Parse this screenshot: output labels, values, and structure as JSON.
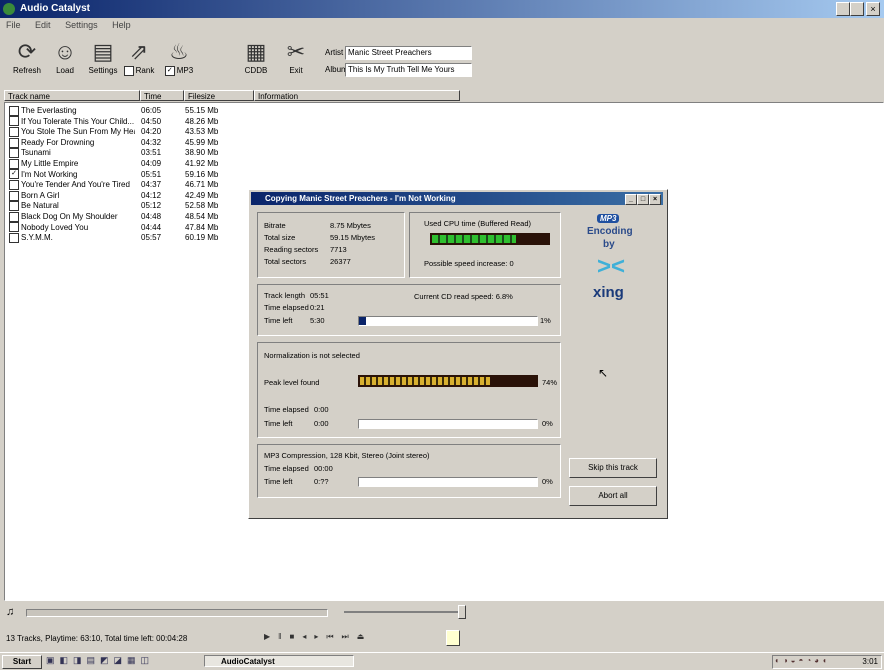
{
  "window": {
    "title": "Audio Catalyst"
  },
  "menu": [
    "File",
    "Edit",
    "Settings",
    "Help"
  ],
  "toolbar": {
    "buttons": [
      {
        "label": "Refresh",
        "icon": "refresh-icon"
      },
      {
        "label": "Load",
        "icon": "load-icon"
      },
      {
        "label": "Settings",
        "icon": "settings-icon"
      },
      {
        "label": "Rank",
        "icon": "rank-icon"
      },
      {
        "label": "MP3",
        "icon": "mp3-icon"
      },
      {
        "label": "CDDB",
        "icon": "cddb-icon"
      },
      {
        "label": "Exit",
        "icon": "exit-icon"
      }
    ],
    "artist_label": "Artist",
    "artist_value": "Manic Street Preachers",
    "album_label": "Album",
    "album_value": "This Is My Truth Tell Me Yours"
  },
  "columns": [
    "Track name",
    "Time",
    "Filesize",
    "Information"
  ],
  "tracks": [
    {
      "name": "The Everlasting",
      "time": "06:05",
      "size": "55.15 Mb",
      "checked": false
    },
    {
      "name": "If You Tolerate This Your Child...",
      "time": "04:50",
      "size": "48.26 Mb",
      "checked": false
    },
    {
      "name": "You Stole The Sun From My Heart",
      "time": "04:20",
      "size": "43.53 Mb",
      "checked": false
    },
    {
      "name": "Ready For Drowning",
      "time": "04:32",
      "size": "45.99 Mb",
      "checked": false
    },
    {
      "name": "Tsunami",
      "time": "03:51",
      "size": "38.90 Mb",
      "checked": false
    },
    {
      "name": "My Little Empire",
      "time": "04:09",
      "size": "41.92 Mb",
      "checked": false
    },
    {
      "name": "I'm Not Working",
      "time": "05:51",
      "size": "59.16 Mb",
      "checked": true
    },
    {
      "name": "You're Tender And You're Tired",
      "time": "04:37",
      "size": "46.71 Mb",
      "checked": false
    },
    {
      "name": "Born A Girl",
      "time": "04:12",
      "size": "42.49 Mb",
      "checked": false
    },
    {
      "name": "Be Natural",
      "time": "05:12",
      "size": "52.58 Mb",
      "checked": false
    },
    {
      "name": "Black Dog On My Shoulder",
      "time": "04:48",
      "size": "48.54 Mb",
      "checked": false
    },
    {
      "name": "Nobody Loved You",
      "time": "04:44",
      "size": "47.84 Mb",
      "checked": false
    },
    {
      "name": "S.Y.M.M.",
      "time": "05:57",
      "size": "60.19 Mb",
      "checked": false
    }
  ],
  "dialog": {
    "title": "Copying Manic Street Preachers - I'm Not Working",
    "stats": [
      {
        "label": "Bitrate",
        "value": "8.75 Mbytes"
      },
      {
        "label": "Total size",
        "value": "59.15 Mbytes"
      },
      {
        "label": "Reading sectors",
        "value": "7713"
      },
      {
        "label": "Total sectors",
        "value": "26377"
      }
    ],
    "cpu_label": "Used CPU time (Buffered Read)",
    "speed_label": "Possible speed increase: 0",
    "track_length_label": "Track length",
    "track_length": "05:51",
    "time_elapsed_label": "Time elapsed",
    "time_elapsed": "0:21",
    "time_left_label": "Time left",
    "time_left": "5:30",
    "read_speed": "Current CD read speed: 6.8%",
    "copy_progress_pct": "1%",
    "copy_progress": 0.01,
    "normalization": "Normalization is not selected",
    "peak_label": "Peak level found",
    "peak_pct": "74%",
    "peak_level": 0.74,
    "norm_elapsed": "0:00",
    "norm_left": "0:00",
    "norm_pct": "0%",
    "mp3_label": "MP3 Compression, 128 Kbit, Stereo (Joint stereo)",
    "mp3_elapsed": "00:00",
    "mp3_left": "0:??",
    "mp3_pct": "0%",
    "skip_button": "Skip this track",
    "abort_button": "Abort all",
    "logo_top": "MP3",
    "logo_mid": "Encoding",
    "logo_by": "by",
    "logo_brand": "xing"
  },
  "status": {
    "text": "13 Tracks, Playtime: 63:10, Total time left: 00:04:28",
    "position": 0.95
  },
  "taskbar": {
    "start": "Start",
    "task": "AudioCatalyst",
    "clock": "3:01"
  }
}
